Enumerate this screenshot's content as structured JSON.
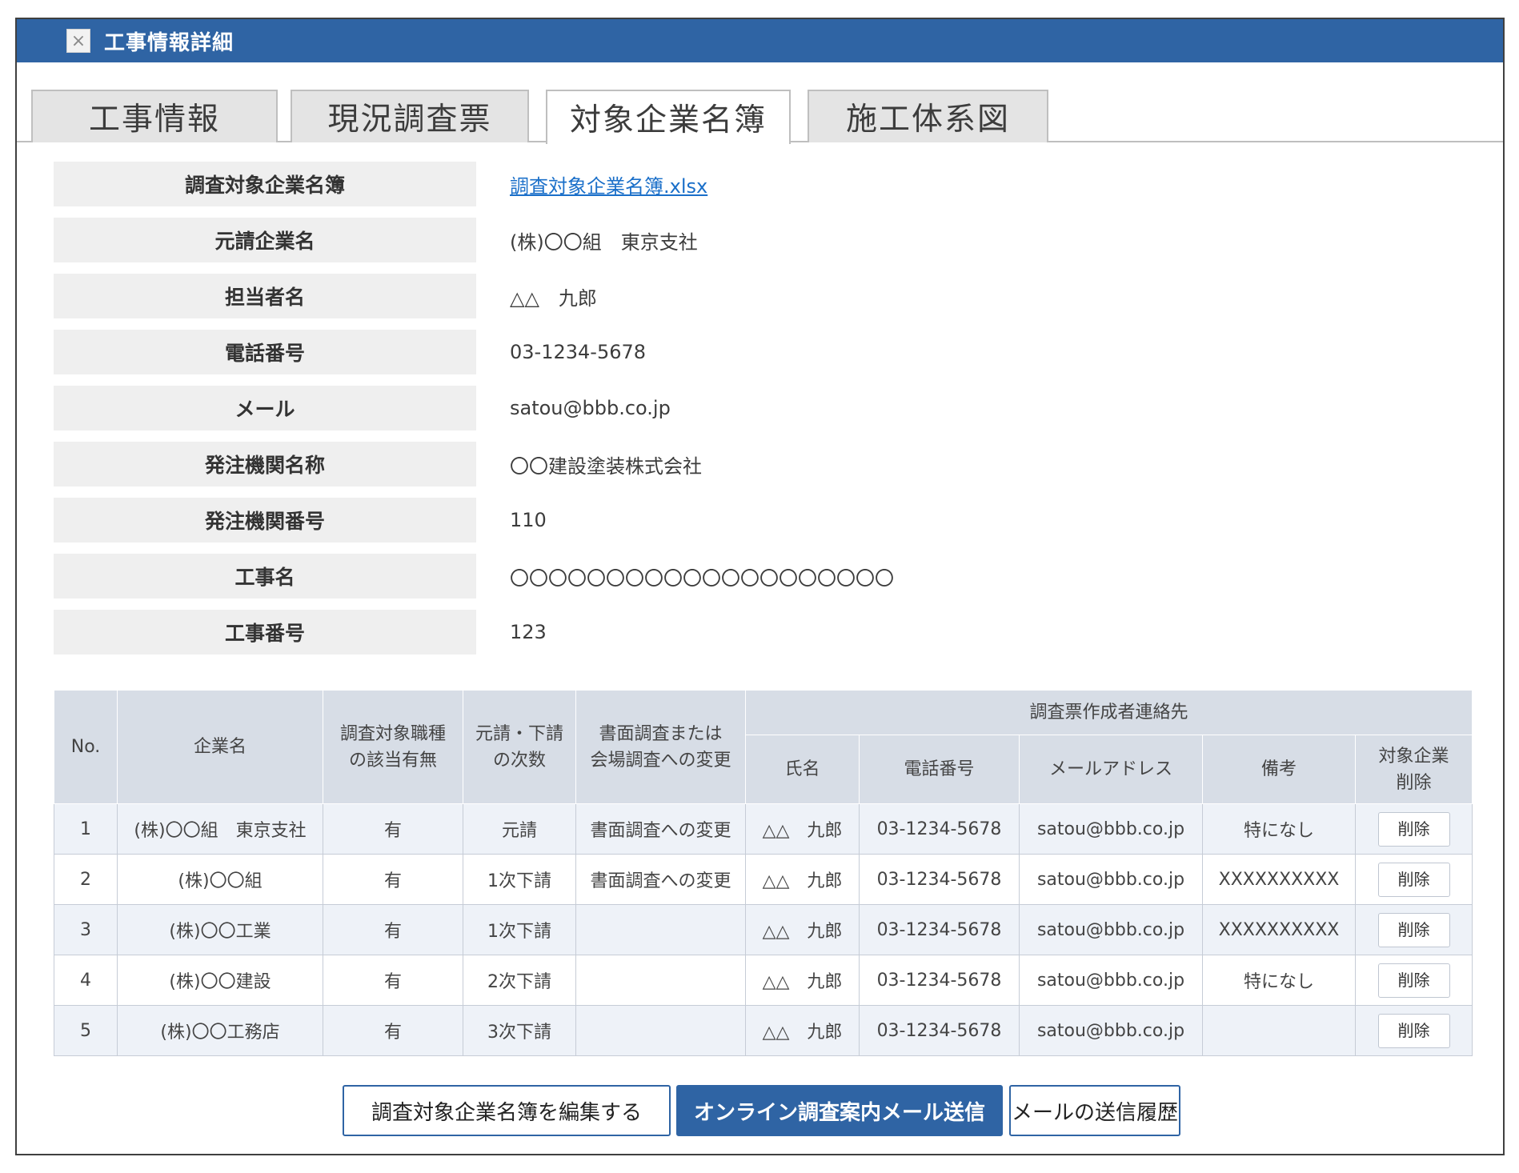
{
  "window": {
    "title": "工事情報詳細",
    "close_glyph": "×"
  },
  "tabs": [
    {
      "label": "工事情報",
      "active": false
    },
    {
      "label": "現況調査票",
      "active": false
    },
    {
      "label": "対象企業名簿",
      "active": true
    },
    {
      "label": "施工体系図",
      "active": false
    }
  ],
  "info": {
    "company_list": {
      "label": "調査対象企業名簿",
      "value": "調査対象企業名簿.xlsx"
    },
    "prime_contractor": {
      "label": "元請企業名",
      "value": "(株)〇〇組　東京支社"
    },
    "contact_person": {
      "label": "担当者名",
      "value": "△△　九郎"
    },
    "phone": {
      "label": "電話番号",
      "value": "03-1234-5678"
    },
    "email": {
      "label": "メール",
      "value": "satou@bbb.co.jp"
    },
    "client_name": {
      "label": "発注機関名称",
      "value": "〇〇建設塗装株式会社"
    },
    "client_number": {
      "label": "発注機関番号",
      "value": "110"
    },
    "project_name": {
      "label": "工事名",
      "value": "〇〇〇〇〇〇〇〇〇〇〇〇〇〇〇〇〇〇〇〇"
    },
    "project_number": {
      "label": "工事番号",
      "value": "123"
    }
  },
  "table": {
    "headers": {
      "no": "No.",
      "company": "企業名",
      "job_type_line1": "調査対象職種",
      "job_type_line2": "の該当有無",
      "tier_line1": "元請・下請",
      "tier_line2": "の次数",
      "survey_change_line1": "書面調査または",
      "survey_change_line2": "会場調査への変更",
      "contact_group": "調査票作成者連絡先",
      "name": "氏名",
      "phone": "電話番号",
      "email": "メールアドレス",
      "note": "備考",
      "delete_line1": "対象企業",
      "delete_line2": "削除"
    },
    "rows": [
      {
        "no": "1",
        "company": "(株)〇〇組　東京支社",
        "applicable": "有",
        "tier": "元請",
        "survey_change": "書面調査への変更",
        "name": "△△　九郎",
        "phone": "03-1234-5678",
        "email": "satou@bbb.co.jp",
        "note": "特になし",
        "delete_label": "削除"
      },
      {
        "no": "2",
        "company": "(株)〇〇組",
        "applicable": "有",
        "tier": "1次下請",
        "survey_change": "書面調査への変更",
        "name": "△△　九郎",
        "phone": "03-1234-5678",
        "email": "satou@bbb.co.jp",
        "note": "XXXXXXXXXX",
        "delete_label": "削除"
      },
      {
        "no": "3",
        "company": "(株)〇〇工業",
        "applicable": "有",
        "tier": "1次下請",
        "survey_change": "",
        "name": "△△　九郎",
        "phone": "03-1234-5678",
        "email": "satou@bbb.co.jp",
        "note": "XXXXXXXXXX",
        "delete_label": "削除"
      },
      {
        "no": "4",
        "company": "(株)〇〇建設",
        "applicable": "有",
        "tier": "2次下請",
        "survey_change": "",
        "name": "△△　九郎",
        "phone": "03-1234-5678",
        "email": "satou@bbb.co.jp",
        "note": "特になし",
        "delete_label": "削除"
      },
      {
        "no": "5",
        "company": "(株)〇〇工務店",
        "applicable": "有",
        "tier": "3次下請",
        "survey_change": "",
        "name": "△△　九郎",
        "phone": "03-1234-5678",
        "email": "satou@bbb.co.jp",
        "note": "",
        "delete_label": "削除"
      }
    ]
  },
  "actions": {
    "edit_list": "調査対象企業名簿を編集する",
    "send_mail": "オンライン調査案内メール送信",
    "mail_history": "メールの送信履歴"
  },
  "colors": {
    "titlebar": "#2f64a4",
    "link": "#1a6fc9",
    "header_bg": "#d7dde6",
    "stripe_bg": "#eef2f8"
  }
}
